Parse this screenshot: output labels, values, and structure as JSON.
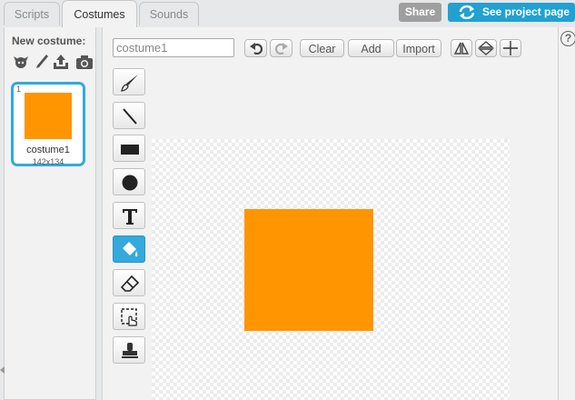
{
  "tabs": [
    {
      "label": "Scripts",
      "active": false
    },
    {
      "label": "Costumes",
      "active": true
    },
    {
      "label": "Sounds",
      "active": false
    }
  ],
  "header": {
    "share_label": "Share",
    "see_project_label": "See project page"
  },
  "left_panel": {
    "new_costume_label": "New costume:",
    "icons": [
      "sprite-library-icon",
      "paint-brush-icon",
      "upload-icon",
      "camera-icon"
    ]
  },
  "costume": {
    "number": "1",
    "name": "costume1",
    "size": "142x134",
    "color": "#ff9500"
  },
  "editor": {
    "name_value": "costume1",
    "undo_icon": "undo-icon",
    "redo_icon": "redo-icon",
    "clear_label": "Clear",
    "add_label": "Add",
    "import_label": "Import",
    "flip_horizontal_icon": "flip-horizontal-icon",
    "flip_vertical_icon": "flip-vertical-icon",
    "set_center_icon": "set-center-icon"
  },
  "tools": [
    {
      "name": "brush-tool",
      "selected": false
    },
    {
      "name": "line-tool",
      "selected": false
    },
    {
      "name": "rectangle-tool",
      "selected": false
    },
    {
      "name": "ellipse-tool",
      "selected": false
    },
    {
      "name": "text-tool",
      "selected": false
    },
    {
      "name": "fill-tool",
      "selected": true
    },
    {
      "name": "eraser-tool",
      "selected": false
    },
    {
      "name": "select-tool",
      "selected": false
    },
    {
      "name": "stamp-tool",
      "selected": false
    }
  ],
  "colors": {
    "accent": "#21a1d2",
    "selected_tool": "#33a9dd",
    "share_button": "#9f9f9f",
    "costume_fill": "#ff9500"
  },
  "help_label": "?"
}
